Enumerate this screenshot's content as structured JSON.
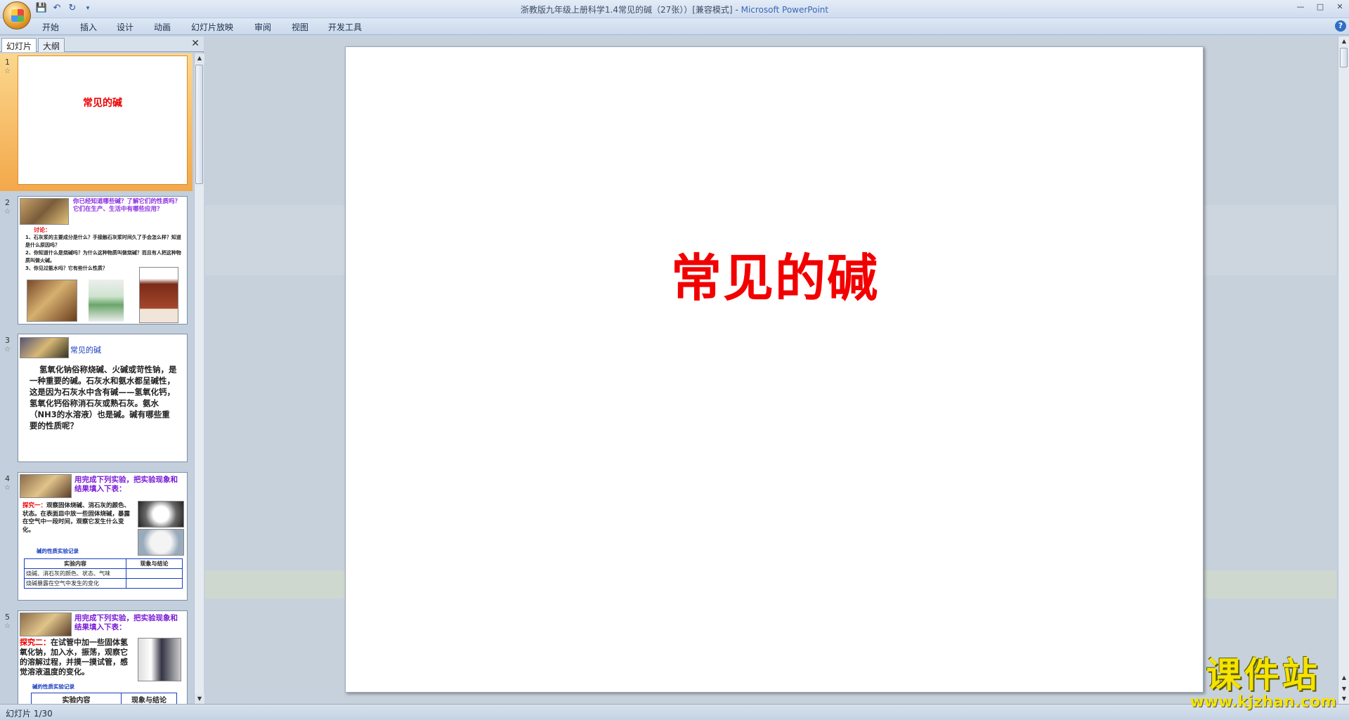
{
  "window": {
    "title_doc": "浙教版九年级上册科学1.4常见的碱（27张））[兼容模式]",
    "title_sep": " - ",
    "title_app": "Microsoft PowerPoint"
  },
  "ribbon": {
    "tabs": [
      "开始",
      "插入",
      "设计",
      "动画",
      "幻灯片放映",
      "审阅",
      "视图",
      "开发工具"
    ]
  },
  "panel": {
    "tab_slides": "幻灯片",
    "tab_outline": "大纲",
    "close": "✕"
  },
  "thumbnails": [
    {
      "num": "1",
      "title": "常见的碱"
    },
    {
      "num": "2",
      "heading": "你已经知道哪些碱？了解它们的性质吗？它们在生产、生活中有哪些应用？",
      "discuss": "讨论：",
      "lines": [
        "1、石灰浆的主要成分是什么？手接触石灰浆时间久了手会怎么样？知道是什么原因吗？",
        "2、你知道什么是烧碱吗？为什么这种物质叫做烧碱？而且有人把这种物质叫做火碱。",
        "3、你见过氨水吗？它有些什么性质？"
      ]
    },
    {
      "num": "3",
      "heading": "常见的碱",
      "body": "氢氧化钠俗称烧碱、火碱或苛性钠，是一种重要的碱。石灰水和氨水都呈碱性，这是因为石灰水中含有碱——氢氧化钙，氢氧化钙俗称消石灰或熟石灰。氨水（NH3的水溶液）也是碱。碱有哪些重要的性质呢？"
    },
    {
      "num": "4",
      "heading": "用完成下列实验，把实验现象和结果填入下表：",
      "lead": "探究一：",
      "body": "观察固体烧碱、消石灰的颜色、状态。在表面皿中放一些固体烧碱，暴露在空气中一段时间，观察它发生什么变化。",
      "table_title": "碱的性质实验记录",
      "col1": "实验内容",
      "col2": "现象与结论",
      "row1": "烧碱、消石灰的颜色、状态、气味",
      "row2": "烧碱暴露在空气中发生的变化"
    },
    {
      "num": "5",
      "heading": "用完成下列实验，把实验现象和结果填入下表：",
      "lead": "探究二：",
      "body": "在试管中加一些固体氢氧化钠，加入水，振荡，观察它的溶解过程，并摸一摸试管，感觉溶液温度的变化。",
      "table_title": "碱的性质实验记录",
      "col1": "实验内容",
      "col2": "现象与结论"
    }
  ],
  "slide": {
    "title": "常见的碱"
  },
  "status": {
    "text": "幻灯片 1/30"
  },
  "watermark": {
    "big": "课件站",
    "small": "www.kjzhan.com"
  },
  "colors": {
    "slide_title": "#f20000",
    "selection": "#f3a84a"
  }
}
